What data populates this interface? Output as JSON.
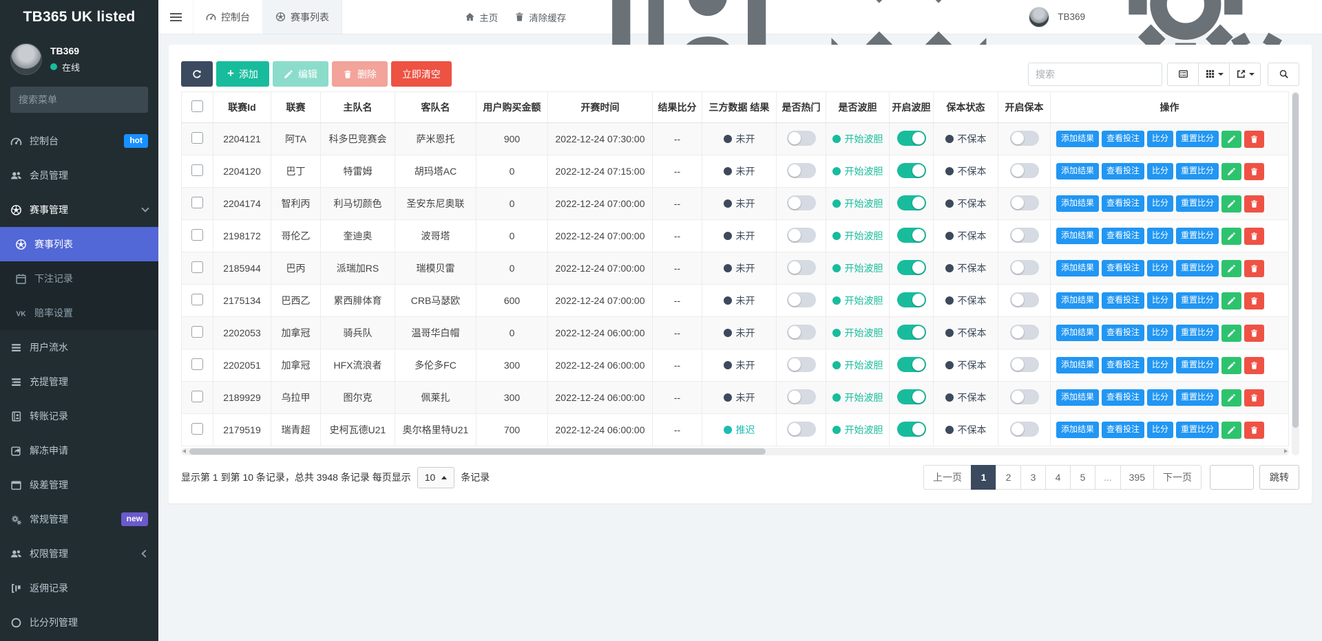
{
  "app": {
    "title": "TB365 UK listed"
  },
  "topbar": {
    "tabs": [
      {
        "key": "console",
        "label": "控制台",
        "icon": "dashboard-icon",
        "active": false
      },
      {
        "key": "match-list",
        "label": "赛事列表",
        "icon": "soccer-icon",
        "active": true
      }
    ],
    "home_label": "主页",
    "clear_cache_label": "清除缓存",
    "username": "TB369"
  },
  "sidebar": {
    "user": {
      "name": "TB369",
      "status_label": "在线"
    },
    "search_placeholder": "搜索菜单",
    "items": [
      {
        "key": "console",
        "label": "控制台",
        "icon": "dashboard-icon",
        "badge": "hot",
        "badge_color": "#1890ff"
      },
      {
        "key": "members",
        "label": "会员管理",
        "icon": "users-icon"
      },
      {
        "key": "match-manage",
        "label": "赛事管理",
        "icon": "soccer-icon",
        "chevron": "down",
        "open": true
      },
      {
        "key": "match-list",
        "label": "赛事列表",
        "icon": "soccer-icon",
        "active": true,
        "submenu": true
      },
      {
        "key": "bet-records",
        "label": "下注记录",
        "icon": "calendar-icon",
        "submenu": true
      },
      {
        "key": "odds-settings",
        "label": "赔率设置",
        "icon": "vk-icon",
        "submenu": true
      },
      {
        "key": "user-flow",
        "label": "用户流水",
        "icon": "list-icon"
      },
      {
        "key": "recharge-withdraw",
        "label": "充提管理",
        "icon": "tasks-icon"
      },
      {
        "key": "transfer-records",
        "label": "转账记录",
        "icon": "book-icon"
      },
      {
        "key": "unfreeze-apply",
        "label": "解冻申请",
        "icon": "share-icon"
      },
      {
        "key": "level-diff",
        "label": "级差管理",
        "icon": "window-icon"
      },
      {
        "key": "general-manage",
        "label": "常规管理",
        "icon": "gears-icon",
        "badge": "new",
        "badge_color": "#6a5acd"
      },
      {
        "key": "permission-manage",
        "label": "权限管理",
        "icon": "users-icon",
        "chevron": "left"
      },
      {
        "key": "rebate-records",
        "label": "返佣记录",
        "icon": "rebate-icon"
      },
      {
        "key": "score-column-manage",
        "label": "比分列管理",
        "icon": "circle-icon"
      }
    ]
  },
  "toolbar": {
    "add_label": "添加",
    "edit_label": "编辑",
    "delete_label": "删除",
    "clear_label": "立即清空",
    "search_placeholder": "搜索"
  },
  "table": {
    "columns": [
      "联赛Id",
      "联赛",
      "主队名",
      "客队名",
      "用户购买金额",
      "开赛时间",
      "结果比分",
      "三方数据 结果",
      "是否热门",
      "是否波胆",
      "开启波胆",
      "保本状态",
      "开启保本",
      "操作"
    ],
    "action_labels": [
      "添加结果",
      "查看投注",
      "比分",
      "重置比分"
    ],
    "rows": [
      {
        "id": "2204121",
        "league": "阿TA",
        "home": "科多巴竞赛会",
        "away": "萨米恩托",
        "amount": "900",
        "time": "2022-12-24 07:30:00",
        "score": "--",
        "third": "未开",
        "third_color": "#3d4a5c",
        "hot_on": false,
        "bodan_label": "开始波胆",
        "bodan_color": "#18bc9c",
        "bodan_on": true,
        "baoben_label": "不保本",
        "baoben_color": "#3d4a5c",
        "baoben_on": false
      },
      {
        "id": "2204120",
        "league": "巴丁",
        "home": "特雷姆",
        "away": "胡玛塔AC",
        "amount": "0",
        "time": "2022-12-24 07:15:00",
        "score": "--",
        "third": "未开",
        "third_color": "#3d4a5c",
        "hot_on": false,
        "bodan_label": "开始波胆",
        "bodan_color": "#18bc9c",
        "bodan_on": true,
        "baoben_label": "不保本",
        "baoben_color": "#3d4a5c",
        "baoben_on": false
      },
      {
        "id": "2204174",
        "league": "智利丙",
        "home": "利马切颜色",
        "away": "圣安东尼奥联",
        "amount": "0",
        "time": "2022-12-24 07:00:00",
        "score": "--",
        "third": "未开",
        "third_color": "#3d4a5c",
        "hot_on": false,
        "bodan_label": "开始波胆",
        "bodan_color": "#18bc9c",
        "bodan_on": true,
        "baoben_label": "不保本",
        "baoben_color": "#3d4a5c",
        "baoben_on": false
      },
      {
        "id": "2198172",
        "league": "哥伦乙",
        "home": "奎迪奥",
        "away": "波哥塔",
        "amount": "0",
        "time": "2022-12-24 07:00:00",
        "score": "--",
        "third": "未开",
        "third_color": "#3d4a5c",
        "hot_on": false,
        "bodan_label": "开始波胆",
        "bodan_color": "#18bc9c",
        "bodan_on": true,
        "baoben_label": "不保本",
        "baoben_color": "#3d4a5c",
        "baoben_on": false
      },
      {
        "id": "2185944",
        "league": "巴丙",
        "home": "派瑞加RS",
        "away": "瑞模贝雷",
        "amount": "0",
        "time": "2022-12-24 07:00:00",
        "score": "--",
        "third": "未开",
        "third_color": "#3d4a5c",
        "hot_on": false,
        "bodan_label": "开始波胆",
        "bodan_color": "#18bc9c",
        "bodan_on": true,
        "baoben_label": "不保本",
        "baoben_color": "#3d4a5c",
        "baoben_on": false
      },
      {
        "id": "2175134",
        "league": "巴西乙",
        "home": "累西腓体育",
        "away": "CRB马瑟欧",
        "amount": "600",
        "time": "2022-12-24 07:00:00",
        "score": "--",
        "third": "未开",
        "third_color": "#3d4a5c",
        "hot_on": false,
        "bodan_label": "开始波胆",
        "bodan_color": "#18bc9c",
        "bodan_on": true,
        "baoben_label": "不保本",
        "baoben_color": "#3d4a5c",
        "baoben_on": false
      },
      {
        "id": "2202053",
        "league": "加拿冠",
        "home": "骑兵队",
        "away": "温哥华白帽",
        "amount": "0",
        "time": "2022-12-24 06:00:00",
        "score": "--",
        "third": "未开",
        "third_color": "#3d4a5c",
        "hot_on": false,
        "bodan_label": "开始波胆",
        "bodan_color": "#18bc9c",
        "bodan_on": true,
        "baoben_label": "不保本",
        "baoben_color": "#3d4a5c",
        "baoben_on": false
      },
      {
        "id": "2202051",
        "league": "加拿冠",
        "home": "HFX流浪者",
        "away": "多伦多FC",
        "amount": "300",
        "time": "2022-12-24 06:00:00",
        "score": "--",
        "third": "未开",
        "third_color": "#3d4a5c",
        "hot_on": false,
        "bodan_label": "开始波胆",
        "bodan_color": "#18bc9c",
        "bodan_on": true,
        "baoben_label": "不保本",
        "baoben_color": "#3d4a5c",
        "baoben_on": false
      },
      {
        "id": "2189929",
        "league": "乌拉甲",
        "home": "图尔克",
        "away": "佩莱扎",
        "amount": "300",
        "time": "2022-12-24 06:00:00",
        "score": "--",
        "third": "未开",
        "third_color": "#3d4a5c",
        "hot_on": false,
        "bodan_label": "开始波胆",
        "bodan_color": "#18bc9c",
        "bodan_on": true,
        "baoben_label": "不保本",
        "baoben_color": "#3d4a5c",
        "baoben_on": false
      },
      {
        "id": "2179519",
        "league": "瑞青超",
        "home": "史柯瓦德U21",
        "away": "奥尔格里特U21",
        "amount": "700",
        "time": "2022-12-24 06:00:00",
        "score": "--",
        "third": "推迟",
        "third_color": "#1cbbb4",
        "hot_on": false,
        "bodan_label": "开始波胆",
        "bodan_color": "#18bc9c",
        "bodan_on": true,
        "baoben_label": "不保本",
        "baoben_color": "#3d4a5c",
        "baoben_on": false
      }
    ]
  },
  "pagination": {
    "info_prefix": "显示第 1 到第 10 条记录，总共 3948 条记录 每页显示",
    "page_size": "10",
    "info_suffix": "条记录",
    "prev_label": "上一页",
    "next_label": "下一页",
    "pages": [
      "1",
      "2",
      "3",
      "4",
      "5",
      "...",
      "395"
    ],
    "active_page": "1",
    "jump_label": "跳转"
  },
  "colors": {
    "sidebar_bg": "#222d32",
    "active_menu": "#5168d6",
    "primary_dark": "#3b4a5f",
    "success": "#18bc9c",
    "danger": "#ed5243",
    "action_blue": "#2196f3",
    "toggle_on": "#18bc9c",
    "hot_badge": "#1890ff",
    "new_badge": "#6a5acd",
    "status_dark": "#3d4a5c",
    "status_delay": "#1cbbb4"
  }
}
